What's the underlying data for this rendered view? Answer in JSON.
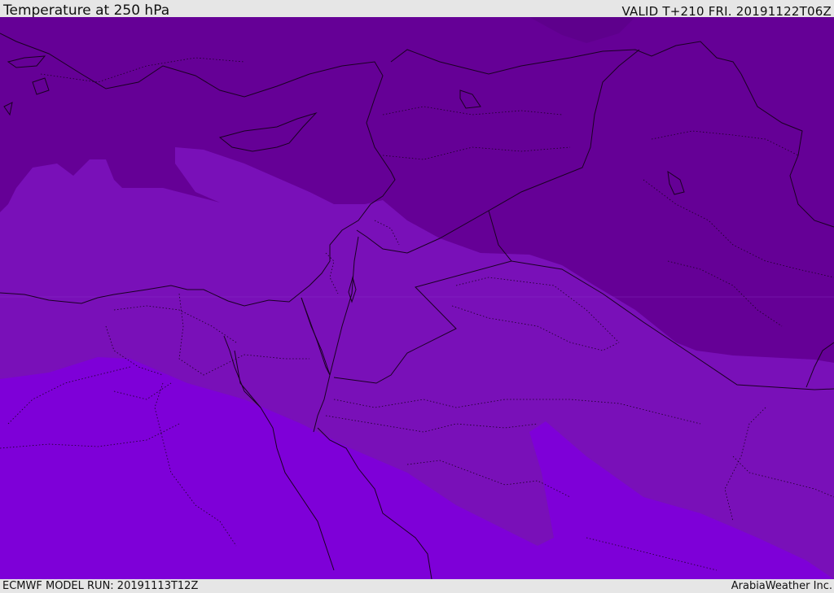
{
  "header": {
    "title": "Temperature at 250 hPa",
    "valid": "VALID T+210 FRI. 20191122T06Z"
  },
  "footer": {
    "model_run": "ECMWF MODEL RUN: 20191113T12Z",
    "credit": "ArabiaWeather Inc."
  },
  "map": {
    "colors": {
      "cold_band": "#650096",
      "mid_band": "#7910b8",
      "warm_band": "#7e00d8",
      "coastline": "#1a0022",
      "borders": "#1a0022"
    }
  }
}
